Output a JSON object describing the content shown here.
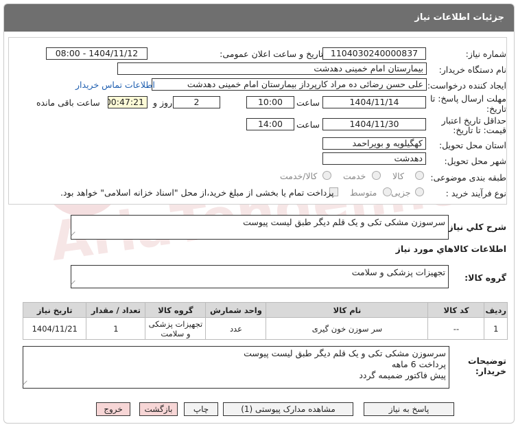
{
  "header": {
    "title": "جزئیات اطلاعات نیاز"
  },
  "fields": {
    "need_number_label": "شماره نیاز:",
    "need_number": "1104030240000837",
    "announce_label": "تاریخ و ساعت اعلان عمومی:",
    "announce_value": "1404/11/12 - 08:00",
    "buyer_label": "نام دستگاه خریدار:",
    "buyer_value": "بیمارستان امام خمینی دهدشت",
    "creator_label": "ایجاد کننده درخواست:",
    "creator_value": "علی حسن رضائی ده مراد کارپرداز بیمارستان امام خمینی دهدشت",
    "contact_link": "اطلاعات تماس خریدار",
    "deadline_label_1": "مهلت ارسال پاسخ: تا",
    "deadline_label_2": "تاریخ:",
    "deadline_date": "1404/11/14",
    "time_label": "ساعت",
    "deadline_time": "10:00",
    "days_value": "2",
    "days_label": "روز و",
    "remaining_value": "00:47:21",
    "remaining_label": "ساعت باقی مانده",
    "validity_label_1": "حداقل تاریخ اعتبار",
    "validity_label_2": "قیمت: تا تاریخ:",
    "validity_date": "1404/11/30",
    "validity_time": "14:00",
    "province_label": "استان محل تحویل:",
    "province_value": "کهگیلویه و بویراحمد",
    "city_label": "شهر محل تحویل:",
    "city_value": "دهدشت",
    "category_label": "طبقه بندی موضوعی:",
    "category_options": [
      "کالا",
      "خدمت",
      "کالا/خدمت"
    ],
    "process_label": "نوع فرآیند خرید :",
    "process_options": [
      "جزیی",
      "متوسط"
    ],
    "payment_note": "پرداخت تمام یا بخشی از مبلغ خرید،از محل \"اسناد خزانه اسلامی\" خواهد بود."
  },
  "summary": {
    "label": "شرح کلي نياز:",
    "value": "سرسوزن مشکی تکی و یک قلم دیگر طبق لیست پیوست"
  },
  "goods_info_label": "اطلاعات کالاهاي مورد نياز",
  "goods_group": {
    "label": "گروه کالا:",
    "value": "تجهیزات پزشکی و سلامت"
  },
  "table": {
    "headers": [
      "ردیف",
      "کد کالا",
      "نام کالا",
      "واحد شمارش",
      "گروه کالا",
      "تعداد / مقدار",
      "تاریخ نیاز"
    ],
    "rows": [
      {
        "row": "1",
        "code": "--",
        "name": "سر سوزن خون گیری",
        "unit": "عدد",
        "group": "تجهیزات پزشکی و سلامت",
        "qty": "1",
        "date": "1404/11/21"
      }
    ]
  },
  "buyer_notes": {
    "label_1": "توضیحات",
    "label_2": "خریدار:",
    "line1": "سرسوزن مشکی تکی و یک قلم دیگر طبق لیست پیوست",
    "line2": "پرداخت 6 ماهه",
    "line3": "پیش فاکتور ضمیمه گردد"
  },
  "buttons": {
    "reply": "پاسخ به نیاز",
    "attachments": "مشاهده مدارک پیوستی (1)",
    "print": "چاپ",
    "back": "بازگشت",
    "exit": "خروج"
  }
}
